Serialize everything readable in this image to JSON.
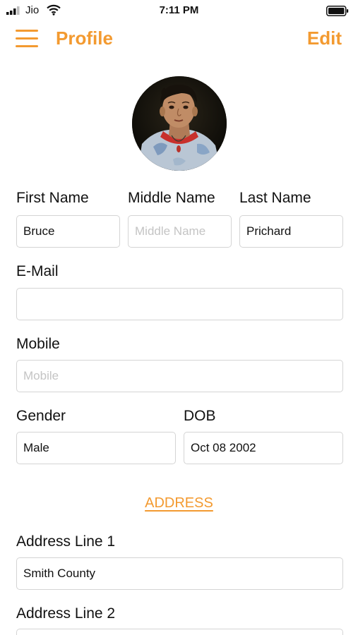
{
  "status_bar": {
    "carrier": "Jio",
    "time": "7:11 PM"
  },
  "header": {
    "title": "Profile",
    "edit_label": "Edit"
  },
  "colors": {
    "accent": "#f39a30",
    "border": "#d4d4d4",
    "placeholder": "#c4c4c4"
  },
  "icons": {
    "menu": "hamburger-menu-icon",
    "signal": "signal-icon",
    "wifi": "wifi-icon",
    "battery": "battery-icon"
  },
  "form": {
    "first_name": {
      "label": "First Name",
      "value": "Bruce",
      "placeholder": ""
    },
    "middle_name": {
      "label": "Middle Name",
      "value": "",
      "placeholder": "Middle Name"
    },
    "last_name": {
      "label": "Last Name",
      "value": "Prichard",
      "placeholder": ""
    },
    "email": {
      "label": "E-Mail",
      "value": "",
      "placeholder": ""
    },
    "mobile": {
      "label": "Mobile",
      "value": "",
      "placeholder": "Mobile"
    },
    "gender": {
      "label": "Gender",
      "value": "Male",
      "placeholder": ""
    },
    "dob": {
      "label": "DOB",
      "value": "Oct 08 2002",
      "placeholder": ""
    }
  },
  "address": {
    "section_title": "ADDRESS",
    "line1": {
      "label": "Address Line 1",
      "value": "Smith County",
      "placeholder": ""
    },
    "line2": {
      "label": "Address Line 2",
      "value": "",
      "placeholder": ""
    }
  }
}
